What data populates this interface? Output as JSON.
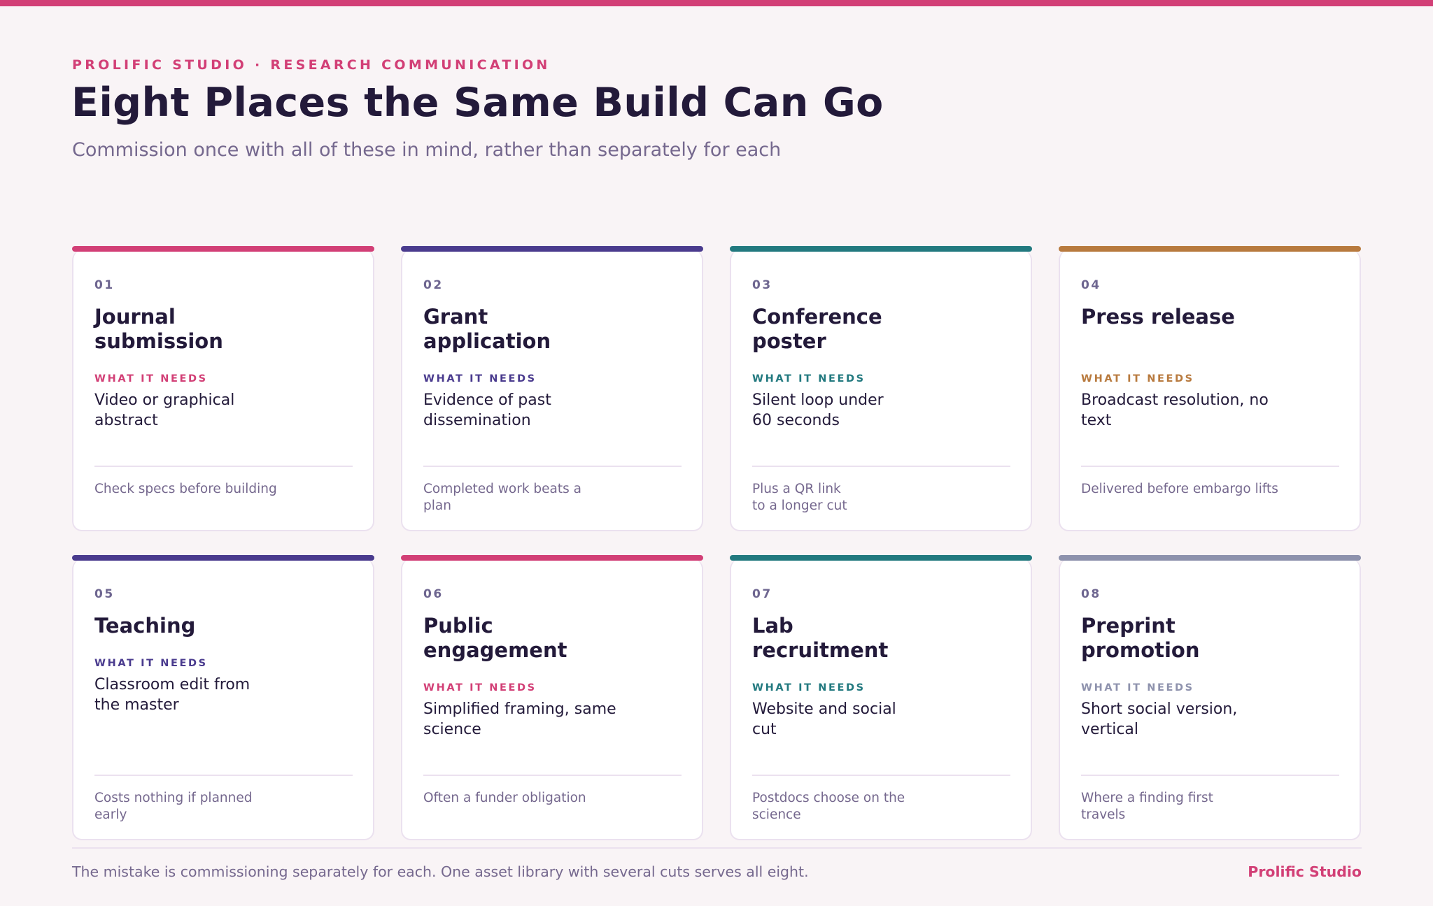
{
  "header": {
    "eyebrow": "PROLIFIC STUDIO · RESEARCH COMMUNICATION",
    "title": "Eight Places the Same Build Can Go",
    "subtitle": "Commission once with all of these in mind, rather than separately for each"
  },
  "colors": {
    "pink": "#d23f76",
    "indigo": "#4a3b8e",
    "teal": "#22797f",
    "amber": "#b87a3e",
    "slate": "#8e92ad"
  },
  "cards": [
    {
      "number": "01",
      "name": "Journal submission",
      "needs_label": "WHAT IT NEEDS",
      "needs": "Video or graphical abstract",
      "note": "Check specs before building",
      "accent": "#d23f76"
    },
    {
      "number": "02",
      "name": "Grant application",
      "needs_label": "WHAT IT NEEDS",
      "needs": "Evidence of past dissemination",
      "note": "Completed work beats a plan",
      "accent": "#4a3b8e"
    },
    {
      "number": "03",
      "name": "Conference poster",
      "needs_label": "WHAT IT NEEDS",
      "needs": "Silent loop under 60 seconds",
      "note": "Plus a QR link to a longer cut",
      "accent": "#22797f"
    },
    {
      "number": "04",
      "name": "Press release",
      "needs_label": "WHAT IT NEEDS",
      "needs": "Broadcast resolution, no text",
      "note": "Delivered before embargo lifts",
      "accent": "#b87a3e"
    },
    {
      "number": "05",
      "name": "Teaching",
      "needs_label": "WHAT IT NEEDS",
      "needs": "Classroom edit from the master",
      "note": "Costs nothing if planned early",
      "accent": "#4a3b8e"
    },
    {
      "number": "06",
      "name": "Public engagement",
      "needs_label": "WHAT IT NEEDS",
      "needs": "Simplified framing, same science",
      "note": "Often a funder obligation",
      "accent": "#d23f76"
    },
    {
      "number": "07",
      "name": "Lab recruitment",
      "needs_label": "WHAT IT NEEDS",
      "needs": "Website and social cut",
      "note": "Postdocs choose on the science",
      "accent": "#22797f"
    },
    {
      "number": "08",
      "name": "Preprint promotion",
      "needs_label": "WHAT IT NEEDS",
      "needs": "Short social version, vertical",
      "note": "Where a finding first travels",
      "accent": "#8e92ad"
    }
  ],
  "footer": {
    "text": "The mistake is commissioning separately for each. One asset library with several cuts serves all eight.",
    "brand": "Prolific Studio"
  }
}
